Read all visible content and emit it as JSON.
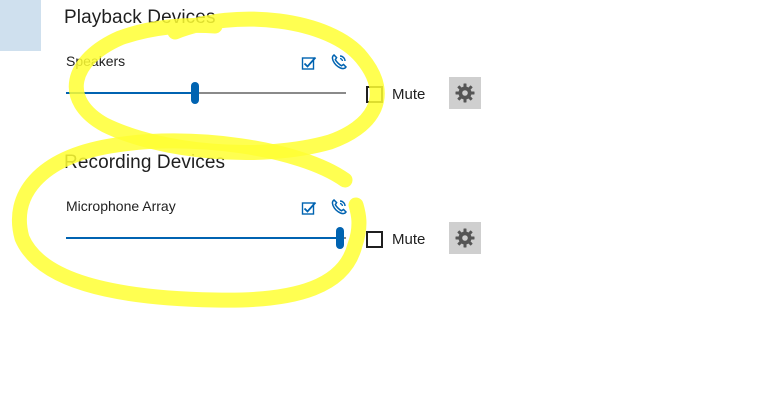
{
  "playback": {
    "title": "Playback Devices",
    "device_name": "Speakers",
    "volume_fraction": 0.46,
    "mute_label": "Mute",
    "muted": false
  },
  "recording": {
    "title": "Recording Devices",
    "device_name": "Microphone Array",
    "volume_fraction": 0.98,
    "mute_label": "Mute",
    "muted": false
  },
  "icons": {
    "default_device": "checkbox-check-icon",
    "communication_device": "phone-icon",
    "settings": "gear-icon"
  },
  "colors": {
    "accent": "#0063b1",
    "highlight": "#ffff33",
    "side_block": "#cfe0ee",
    "gear_button_bg": "#cfcfcf"
  }
}
